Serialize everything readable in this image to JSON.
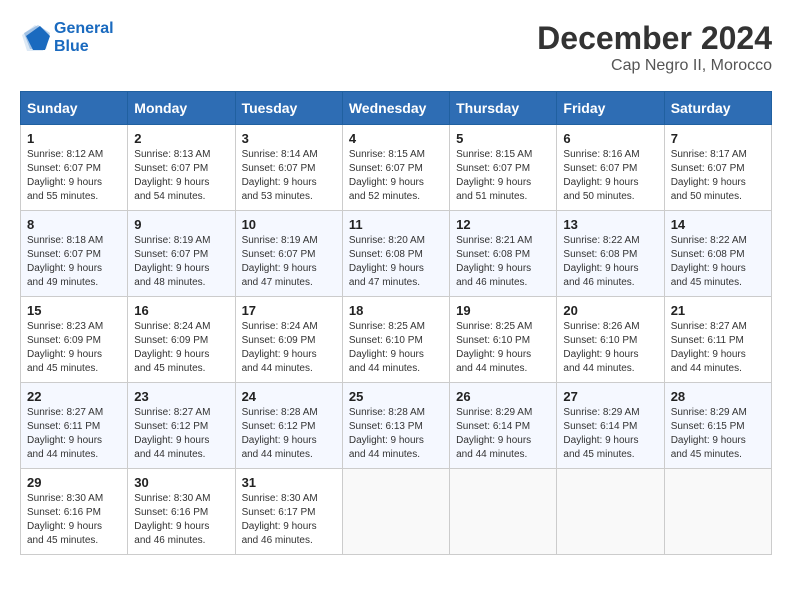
{
  "header": {
    "logo_line1": "General",
    "logo_line2": "Blue",
    "month": "December 2024",
    "location": "Cap Negro II, Morocco"
  },
  "days_of_week": [
    "Sunday",
    "Monday",
    "Tuesday",
    "Wednesday",
    "Thursday",
    "Friday",
    "Saturday"
  ],
  "weeks": [
    [
      {
        "day": "1",
        "sunrise": "Sunrise: 8:12 AM",
        "sunset": "Sunset: 6:07 PM",
        "daylight": "Daylight: 9 hours and 55 minutes."
      },
      {
        "day": "2",
        "sunrise": "Sunrise: 8:13 AM",
        "sunset": "Sunset: 6:07 PM",
        "daylight": "Daylight: 9 hours and 54 minutes."
      },
      {
        "day": "3",
        "sunrise": "Sunrise: 8:14 AM",
        "sunset": "Sunset: 6:07 PM",
        "daylight": "Daylight: 9 hours and 53 minutes."
      },
      {
        "day": "4",
        "sunrise": "Sunrise: 8:15 AM",
        "sunset": "Sunset: 6:07 PM",
        "daylight": "Daylight: 9 hours and 52 minutes."
      },
      {
        "day": "5",
        "sunrise": "Sunrise: 8:15 AM",
        "sunset": "Sunset: 6:07 PM",
        "daylight": "Daylight: 9 hours and 51 minutes."
      },
      {
        "day": "6",
        "sunrise": "Sunrise: 8:16 AM",
        "sunset": "Sunset: 6:07 PM",
        "daylight": "Daylight: 9 hours and 50 minutes."
      },
      {
        "day": "7",
        "sunrise": "Sunrise: 8:17 AM",
        "sunset": "Sunset: 6:07 PM",
        "daylight": "Daylight: 9 hours and 50 minutes."
      }
    ],
    [
      {
        "day": "8",
        "sunrise": "Sunrise: 8:18 AM",
        "sunset": "Sunset: 6:07 PM",
        "daylight": "Daylight: 9 hours and 49 minutes."
      },
      {
        "day": "9",
        "sunrise": "Sunrise: 8:19 AM",
        "sunset": "Sunset: 6:07 PM",
        "daylight": "Daylight: 9 hours and 48 minutes."
      },
      {
        "day": "10",
        "sunrise": "Sunrise: 8:19 AM",
        "sunset": "Sunset: 6:07 PM",
        "daylight": "Daylight: 9 hours and 47 minutes."
      },
      {
        "day": "11",
        "sunrise": "Sunrise: 8:20 AM",
        "sunset": "Sunset: 6:08 PM",
        "daylight": "Daylight: 9 hours and 47 minutes."
      },
      {
        "day": "12",
        "sunrise": "Sunrise: 8:21 AM",
        "sunset": "Sunset: 6:08 PM",
        "daylight": "Daylight: 9 hours and 46 minutes."
      },
      {
        "day": "13",
        "sunrise": "Sunrise: 8:22 AM",
        "sunset": "Sunset: 6:08 PM",
        "daylight": "Daylight: 9 hours and 46 minutes."
      },
      {
        "day": "14",
        "sunrise": "Sunrise: 8:22 AM",
        "sunset": "Sunset: 6:08 PM",
        "daylight": "Daylight: 9 hours and 45 minutes."
      }
    ],
    [
      {
        "day": "15",
        "sunrise": "Sunrise: 8:23 AM",
        "sunset": "Sunset: 6:09 PM",
        "daylight": "Daylight: 9 hours and 45 minutes."
      },
      {
        "day": "16",
        "sunrise": "Sunrise: 8:24 AM",
        "sunset": "Sunset: 6:09 PM",
        "daylight": "Daylight: 9 hours and 45 minutes."
      },
      {
        "day": "17",
        "sunrise": "Sunrise: 8:24 AM",
        "sunset": "Sunset: 6:09 PM",
        "daylight": "Daylight: 9 hours and 44 minutes."
      },
      {
        "day": "18",
        "sunrise": "Sunrise: 8:25 AM",
        "sunset": "Sunset: 6:10 PM",
        "daylight": "Daylight: 9 hours and 44 minutes."
      },
      {
        "day": "19",
        "sunrise": "Sunrise: 8:25 AM",
        "sunset": "Sunset: 6:10 PM",
        "daylight": "Daylight: 9 hours and 44 minutes."
      },
      {
        "day": "20",
        "sunrise": "Sunrise: 8:26 AM",
        "sunset": "Sunset: 6:10 PM",
        "daylight": "Daylight: 9 hours and 44 minutes."
      },
      {
        "day": "21",
        "sunrise": "Sunrise: 8:27 AM",
        "sunset": "Sunset: 6:11 PM",
        "daylight": "Daylight: 9 hours and 44 minutes."
      }
    ],
    [
      {
        "day": "22",
        "sunrise": "Sunrise: 8:27 AM",
        "sunset": "Sunset: 6:11 PM",
        "daylight": "Daylight: 9 hours and 44 minutes."
      },
      {
        "day": "23",
        "sunrise": "Sunrise: 8:27 AM",
        "sunset": "Sunset: 6:12 PM",
        "daylight": "Daylight: 9 hours and 44 minutes."
      },
      {
        "day": "24",
        "sunrise": "Sunrise: 8:28 AM",
        "sunset": "Sunset: 6:12 PM",
        "daylight": "Daylight: 9 hours and 44 minutes."
      },
      {
        "day": "25",
        "sunrise": "Sunrise: 8:28 AM",
        "sunset": "Sunset: 6:13 PM",
        "daylight": "Daylight: 9 hours and 44 minutes."
      },
      {
        "day": "26",
        "sunrise": "Sunrise: 8:29 AM",
        "sunset": "Sunset: 6:14 PM",
        "daylight": "Daylight: 9 hours and 44 minutes."
      },
      {
        "day": "27",
        "sunrise": "Sunrise: 8:29 AM",
        "sunset": "Sunset: 6:14 PM",
        "daylight": "Daylight: 9 hours and 45 minutes."
      },
      {
        "day": "28",
        "sunrise": "Sunrise: 8:29 AM",
        "sunset": "Sunset: 6:15 PM",
        "daylight": "Daylight: 9 hours and 45 minutes."
      }
    ],
    [
      {
        "day": "29",
        "sunrise": "Sunrise: 8:30 AM",
        "sunset": "Sunset: 6:16 PM",
        "daylight": "Daylight: 9 hours and 45 minutes."
      },
      {
        "day": "30",
        "sunrise": "Sunrise: 8:30 AM",
        "sunset": "Sunset: 6:16 PM",
        "daylight": "Daylight: 9 hours and 46 minutes."
      },
      {
        "day": "31",
        "sunrise": "Sunrise: 8:30 AM",
        "sunset": "Sunset: 6:17 PM",
        "daylight": "Daylight: 9 hours and 46 minutes."
      },
      null,
      null,
      null,
      null
    ]
  ]
}
